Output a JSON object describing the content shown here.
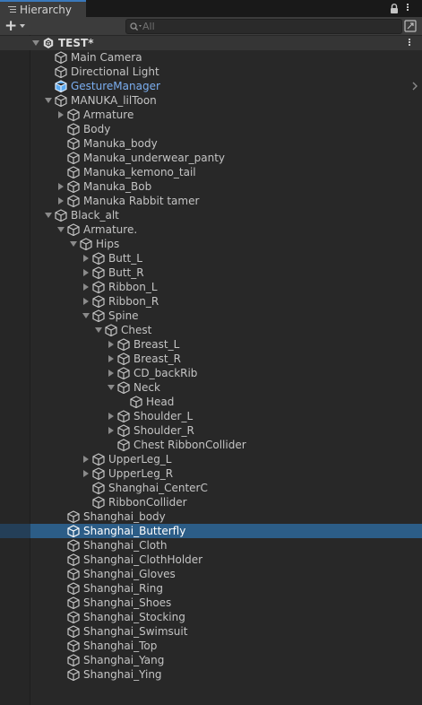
{
  "window": {
    "tab_title": "Hierarchy"
  },
  "toolbar": {
    "search_placeholder": "All"
  },
  "colors": {
    "selection": "#2c5d87",
    "prefab_text": "#7baef0",
    "tab_accent": "#3a79bb"
  },
  "rows": [
    {
      "label": "TEST*",
      "depth": 0,
      "fold": "open",
      "icon": "unity-scene-icon",
      "scene": true
    },
    {
      "label": "Main Camera",
      "depth": 1,
      "fold": "none",
      "icon": "gameobject-icon"
    },
    {
      "label": "Directional Light",
      "depth": 1,
      "fold": "none",
      "icon": "gameobject-icon"
    },
    {
      "label": "GestureManager",
      "depth": 1,
      "fold": "none",
      "icon": "prefab-icon",
      "prefab": true
    },
    {
      "label": "MANUKA_lilToon",
      "depth": 1,
      "fold": "open",
      "icon": "gameobject-icon"
    },
    {
      "label": "Armature",
      "depth": 2,
      "fold": "closed",
      "icon": "gameobject-icon"
    },
    {
      "label": "Body",
      "depth": 2,
      "fold": "none",
      "icon": "gameobject-icon"
    },
    {
      "label": "Manuka_body",
      "depth": 2,
      "fold": "none",
      "icon": "gameobject-icon"
    },
    {
      "label": "Manuka_underwear_panty",
      "depth": 2,
      "fold": "none",
      "icon": "gameobject-icon"
    },
    {
      "label": "Manuka_kemono_tail",
      "depth": 2,
      "fold": "none",
      "icon": "gameobject-icon"
    },
    {
      "label": "Manuka_Bob",
      "depth": 2,
      "fold": "closed",
      "icon": "gameobject-icon"
    },
    {
      "label": "Manuka Rabbit tamer",
      "depth": 2,
      "fold": "closed",
      "icon": "gameobject-icon"
    },
    {
      "label": "Black_alt",
      "depth": 1,
      "fold": "open",
      "icon": "gameobject-icon"
    },
    {
      "label": "Armature.",
      "depth": 2,
      "fold": "open",
      "icon": "gameobject-icon"
    },
    {
      "label": "Hips",
      "depth": 3,
      "fold": "open",
      "icon": "gameobject-icon"
    },
    {
      "label": "Butt_L",
      "depth": 4,
      "fold": "closed",
      "icon": "gameobject-icon"
    },
    {
      "label": "Butt_R",
      "depth": 4,
      "fold": "closed",
      "icon": "gameobject-icon"
    },
    {
      "label": "Ribbon_L",
      "depth": 4,
      "fold": "closed",
      "icon": "gameobject-icon"
    },
    {
      "label": "Ribbon_R",
      "depth": 4,
      "fold": "closed",
      "icon": "gameobject-icon"
    },
    {
      "label": "Spine",
      "depth": 4,
      "fold": "open",
      "icon": "gameobject-icon"
    },
    {
      "label": "Chest",
      "depth": 5,
      "fold": "open",
      "icon": "gameobject-icon"
    },
    {
      "label": "Breast_L",
      "depth": 6,
      "fold": "closed",
      "icon": "gameobject-icon"
    },
    {
      "label": "Breast_R",
      "depth": 6,
      "fold": "closed",
      "icon": "gameobject-icon"
    },
    {
      "label": "CD_backRib",
      "depth": 6,
      "fold": "closed",
      "icon": "gameobject-icon"
    },
    {
      "label": "Neck",
      "depth": 6,
      "fold": "open",
      "icon": "gameobject-icon"
    },
    {
      "label": "Head",
      "depth": 7,
      "fold": "none",
      "icon": "gameobject-icon"
    },
    {
      "label": "Shoulder_L",
      "depth": 6,
      "fold": "closed",
      "icon": "gameobject-icon"
    },
    {
      "label": "Shoulder_R",
      "depth": 6,
      "fold": "closed",
      "icon": "gameobject-icon"
    },
    {
      "label": "Chest RibbonCollider",
      "depth": 6,
      "fold": "none",
      "icon": "gameobject-icon"
    },
    {
      "label": "UpperLeg_L",
      "depth": 4,
      "fold": "closed",
      "icon": "gameobject-icon"
    },
    {
      "label": "UpperLeg_R",
      "depth": 4,
      "fold": "closed",
      "icon": "gameobject-icon"
    },
    {
      "label": "Shanghai_CenterC",
      "depth": 4,
      "fold": "none",
      "icon": "gameobject-icon"
    },
    {
      "label": "RibbonCollider",
      "depth": 4,
      "fold": "none",
      "icon": "gameobject-icon"
    },
    {
      "label": "Shanghai_body",
      "depth": 2,
      "fold": "none",
      "icon": "gameobject-icon"
    },
    {
      "label": "Shanghai_Butterfly",
      "depth": 2,
      "fold": "none",
      "icon": "gameobject-icon",
      "selected": true
    },
    {
      "label": "Shanghai_Cloth",
      "depth": 2,
      "fold": "none",
      "icon": "gameobject-icon"
    },
    {
      "label": "Shanghai_ClothHolder",
      "depth": 2,
      "fold": "none",
      "icon": "gameobject-icon"
    },
    {
      "label": "Shanghai_Gloves",
      "depth": 2,
      "fold": "none",
      "icon": "gameobject-icon"
    },
    {
      "label": "Shanghai_Ring",
      "depth": 2,
      "fold": "none",
      "icon": "gameobject-icon"
    },
    {
      "label": "Shanghai_Shoes",
      "depth": 2,
      "fold": "none",
      "icon": "gameobject-icon"
    },
    {
      "label": "Shanghai_Stocking",
      "depth": 2,
      "fold": "none",
      "icon": "gameobject-icon"
    },
    {
      "label": "Shanghai_Swimsuit",
      "depth": 2,
      "fold": "none",
      "icon": "gameobject-icon"
    },
    {
      "label": "Shanghai_Top",
      "depth": 2,
      "fold": "none",
      "icon": "gameobject-icon"
    },
    {
      "label": "Shanghai_Yang",
      "depth": 2,
      "fold": "none",
      "icon": "gameobject-icon"
    },
    {
      "label": "Shanghai_Ying",
      "depth": 2,
      "fold": "none",
      "icon": "gameobject-icon"
    }
  ]
}
